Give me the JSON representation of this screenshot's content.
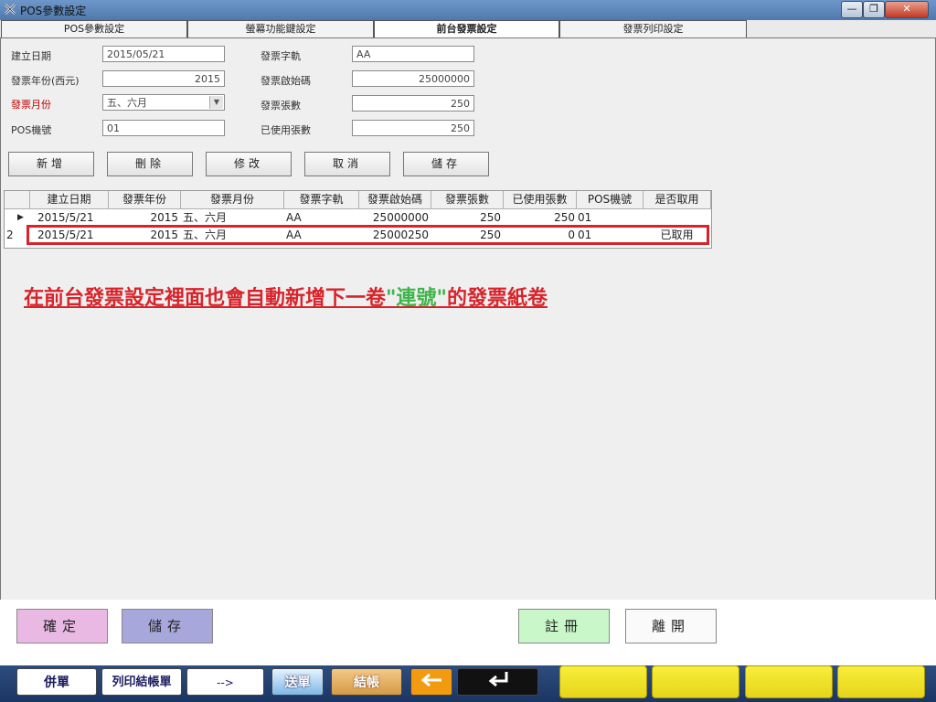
{
  "window": {
    "title": "POS參數設定",
    "minimize": "—",
    "maximize": "❐",
    "close": "✕"
  },
  "tabs": [
    "POS參數設定",
    "螢幕功能鍵設定",
    "前台發票設定",
    "發票列印設定"
  ],
  "active_tab": "前台發票設定",
  "form": {
    "date_label": "建立日期",
    "date_value": "2015/05/21",
    "track_label": "發票字軌",
    "track_value": "AA",
    "year_label": "發票年份(西元)",
    "year_value": "2015",
    "start_label": "發票啟始碼",
    "start_value": "25000000",
    "month_label": "發票月份",
    "month_value": "五、六月",
    "count_label": "發票張數",
    "count_value": "250",
    "pos_label": "POS機號",
    "pos_value": "01",
    "used_label": "已使用張數",
    "used_value": "250"
  },
  "actions": [
    "新增",
    "刪除",
    "修改",
    "取消",
    "儲存"
  ],
  "grid": {
    "columns": [
      "建立日期",
      "發票年份",
      "發票月份",
      "發票字軌",
      "發票啟始碼",
      "發票張數",
      "已使用張數",
      "POS機號",
      "是否取用"
    ],
    "rows": [
      {
        "marker": "▶",
        "date": "2015/5/21",
        "year": "2015",
        "month": "五、六月",
        "track": "AA",
        "start": "25000000",
        "count": "250",
        "used": "250",
        "pos": "01",
        "taken": ""
      },
      {
        "marker": "2",
        "date": "2015/5/21",
        "year": "2015",
        "month": "五、六月",
        "track": "AA",
        "start": "25000250",
        "count": "250",
        "used": "0",
        "pos": "01",
        "taken": "已取用"
      }
    ]
  },
  "annotation": {
    "before": "在前台發票設定裡面也會自動新增下一卷",
    "highlight": "\"連號\"",
    "after": "的發票紙卷"
  },
  "bottom_buttons": {
    "confirm": "確定",
    "save": "儲存",
    "register": "註冊",
    "leave": "離開"
  },
  "taskbar": {
    "merge": "併單",
    "print_checkout": "列印結帳單",
    "arrow": "-->",
    "send": "送單",
    "checkout": "結帳"
  },
  "colors": {
    "accent_red": "#d8232a",
    "highlight_green": "#3db54a",
    "confirm_bg": "#e9b9e4",
    "save_bg": "#a7a7dc",
    "register_bg": "#c9f7c9",
    "taskbar_yellow": "#f2e32a"
  }
}
